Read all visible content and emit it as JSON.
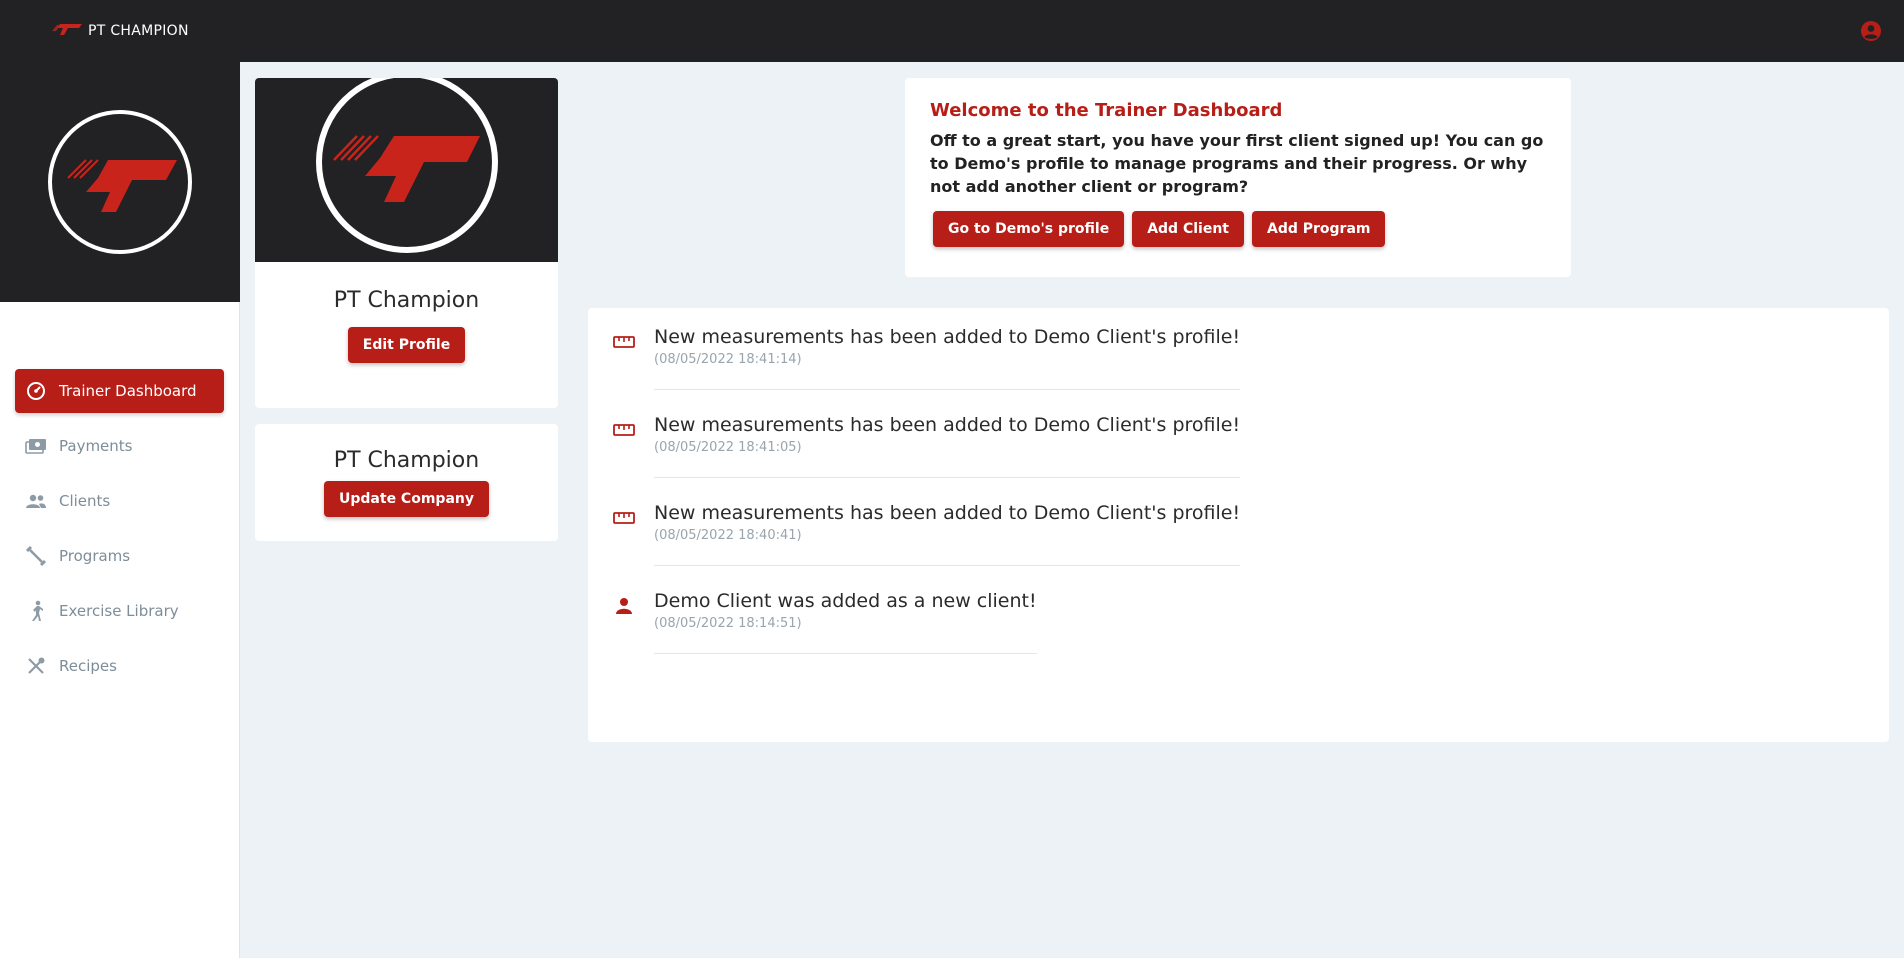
{
  "topbar": {
    "brand": "PT CHAMPION",
    "user_icon": "account-circle-icon",
    "accent": "#b81e18",
    "bar_color": "#222123"
  },
  "sidebar": {
    "items": [
      {
        "label": "Trainer Dashboard",
        "icon": "dashboard-gauge-icon",
        "active": true
      },
      {
        "label": "Payments",
        "icon": "payments-icon",
        "active": false
      },
      {
        "label": "Clients",
        "icon": "people-icon",
        "active": false
      },
      {
        "label": "Programs",
        "icon": "dumbbell-icon",
        "active": false
      },
      {
        "label": "Exercise Library",
        "icon": "running-person-icon",
        "active": false
      },
      {
        "label": "Recipes",
        "icon": "utensils-icon",
        "active": false
      }
    ]
  },
  "profile": {
    "name": "PT Champion",
    "edit_label": "Edit Profile"
  },
  "company": {
    "name": "PT Champion",
    "update_label": "Update Company"
  },
  "welcome": {
    "title": "Welcome to the Trainer Dashboard",
    "text": "Off to a great start, you have your first client signed up! You can go to Demo's profile to manage programs and their progress. Or why not add another client or program?",
    "buttons": [
      "Go to Demo's profile",
      "Add Client",
      "Add Program"
    ]
  },
  "feed": [
    {
      "icon": "ruler-icon",
      "message": "New measurements has been added to Demo Client's profile!",
      "time": "(08/05/2022 18:41:14)"
    },
    {
      "icon": "ruler-icon",
      "message": "New measurements has been added to Demo Client's profile!",
      "time": "(08/05/2022 18:41:05)"
    },
    {
      "icon": "ruler-icon",
      "message": "New measurements has been added to Demo Client's profile!",
      "time": "(08/05/2022 18:40:41)"
    },
    {
      "icon": "person-icon",
      "message": "Demo Client was added as a new client!",
      "time": "(08/05/2022 18:14:51)"
    }
  ]
}
